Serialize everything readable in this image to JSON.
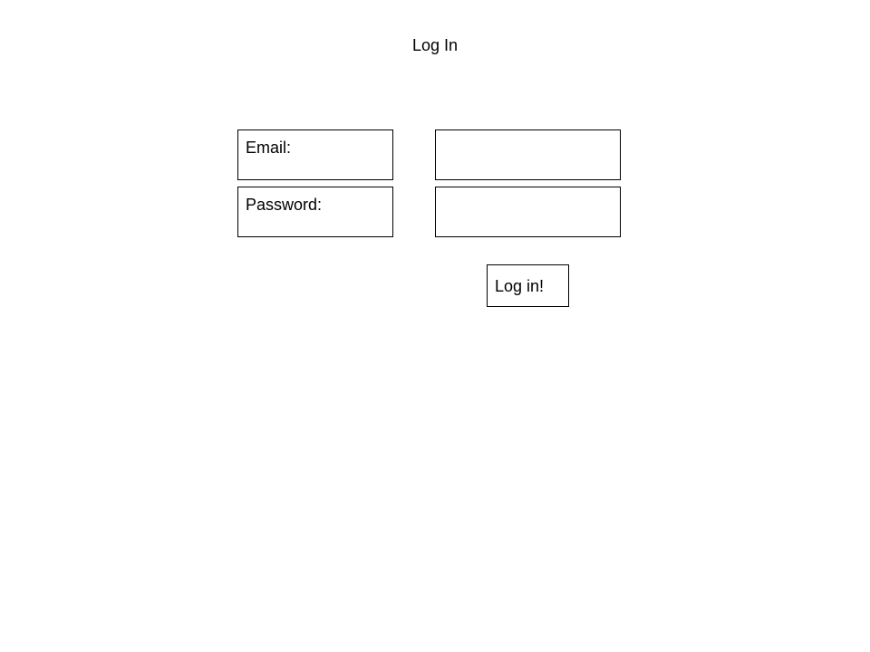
{
  "page": {
    "title": "Log In"
  },
  "form": {
    "email_label": "Email:",
    "email_value": "",
    "password_label": "Password:",
    "password_value": "",
    "submit_label": "Log in!"
  }
}
